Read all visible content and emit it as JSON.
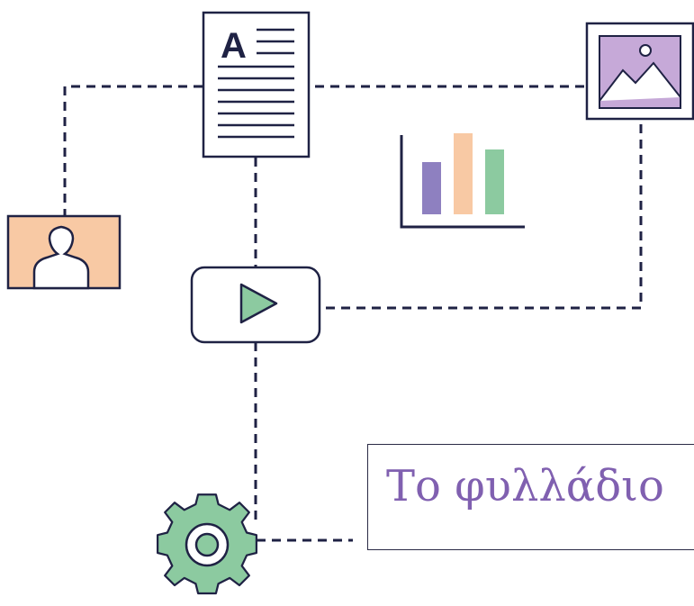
{
  "title": {
    "text": "Το φυλλάδιο"
  },
  "colors": {
    "ink": "#1f2244",
    "title": "#8060b0",
    "peach": "#f8c9a4",
    "lavender": "#c6a9d8",
    "green": "#8ccaa0",
    "bar_purple": "#8e80c0",
    "bar_peach": "#f8c9a4",
    "bar_green": "#8ccaa0"
  },
  "icons": [
    "document-icon",
    "image-icon",
    "bar-chart-icon",
    "user-icon",
    "play-icon",
    "gear-icon"
  ]
}
